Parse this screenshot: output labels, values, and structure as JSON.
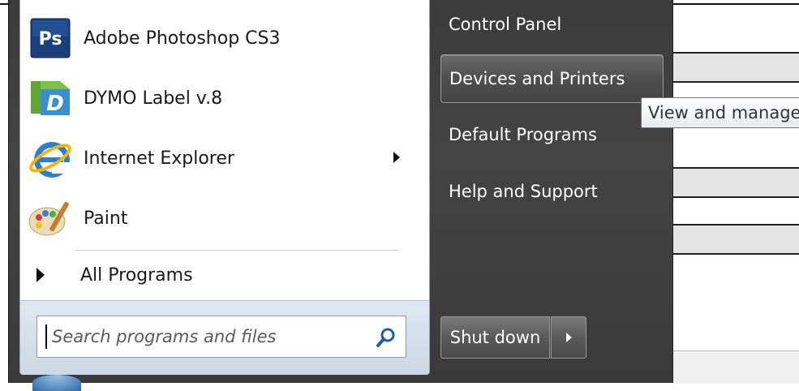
{
  "programs": [
    {
      "label": "Adobe Photoshop CS3",
      "icon": "photoshop-icon",
      "icon_text": "Ps"
    },
    {
      "label": "DYMO Label v.8",
      "icon": "dymo-label-icon",
      "icon_text": "D"
    },
    {
      "label": "Internet Explorer",
      "icon": "internet-explorer-icon",
      "icon_text": "e"
    },
    {
      "label": "Paint",
      "icon": "paint-palette-icon"
    }
  ],
  "all_programs_label": "All Programs",
  "search": {
    "placeholder": "Search programs and files"
  },
  "right_items": [
    {
      "label": "Control Panel"
    },
    {
      "label": "Devices and Printers"
    },
    {
      "label": "Default Programs"
    },
    {
      "label": "Help and Support"
    }
  ],
  "shutdown_label": "Shut down",
  "tooltip": "View and manage",
  "colors": {
    "menu_dark": "#3b3b3b",
    "accent_blue": "#2f6aa8",
    "photoshop_blue": "#1b3f7a"
  }
}
